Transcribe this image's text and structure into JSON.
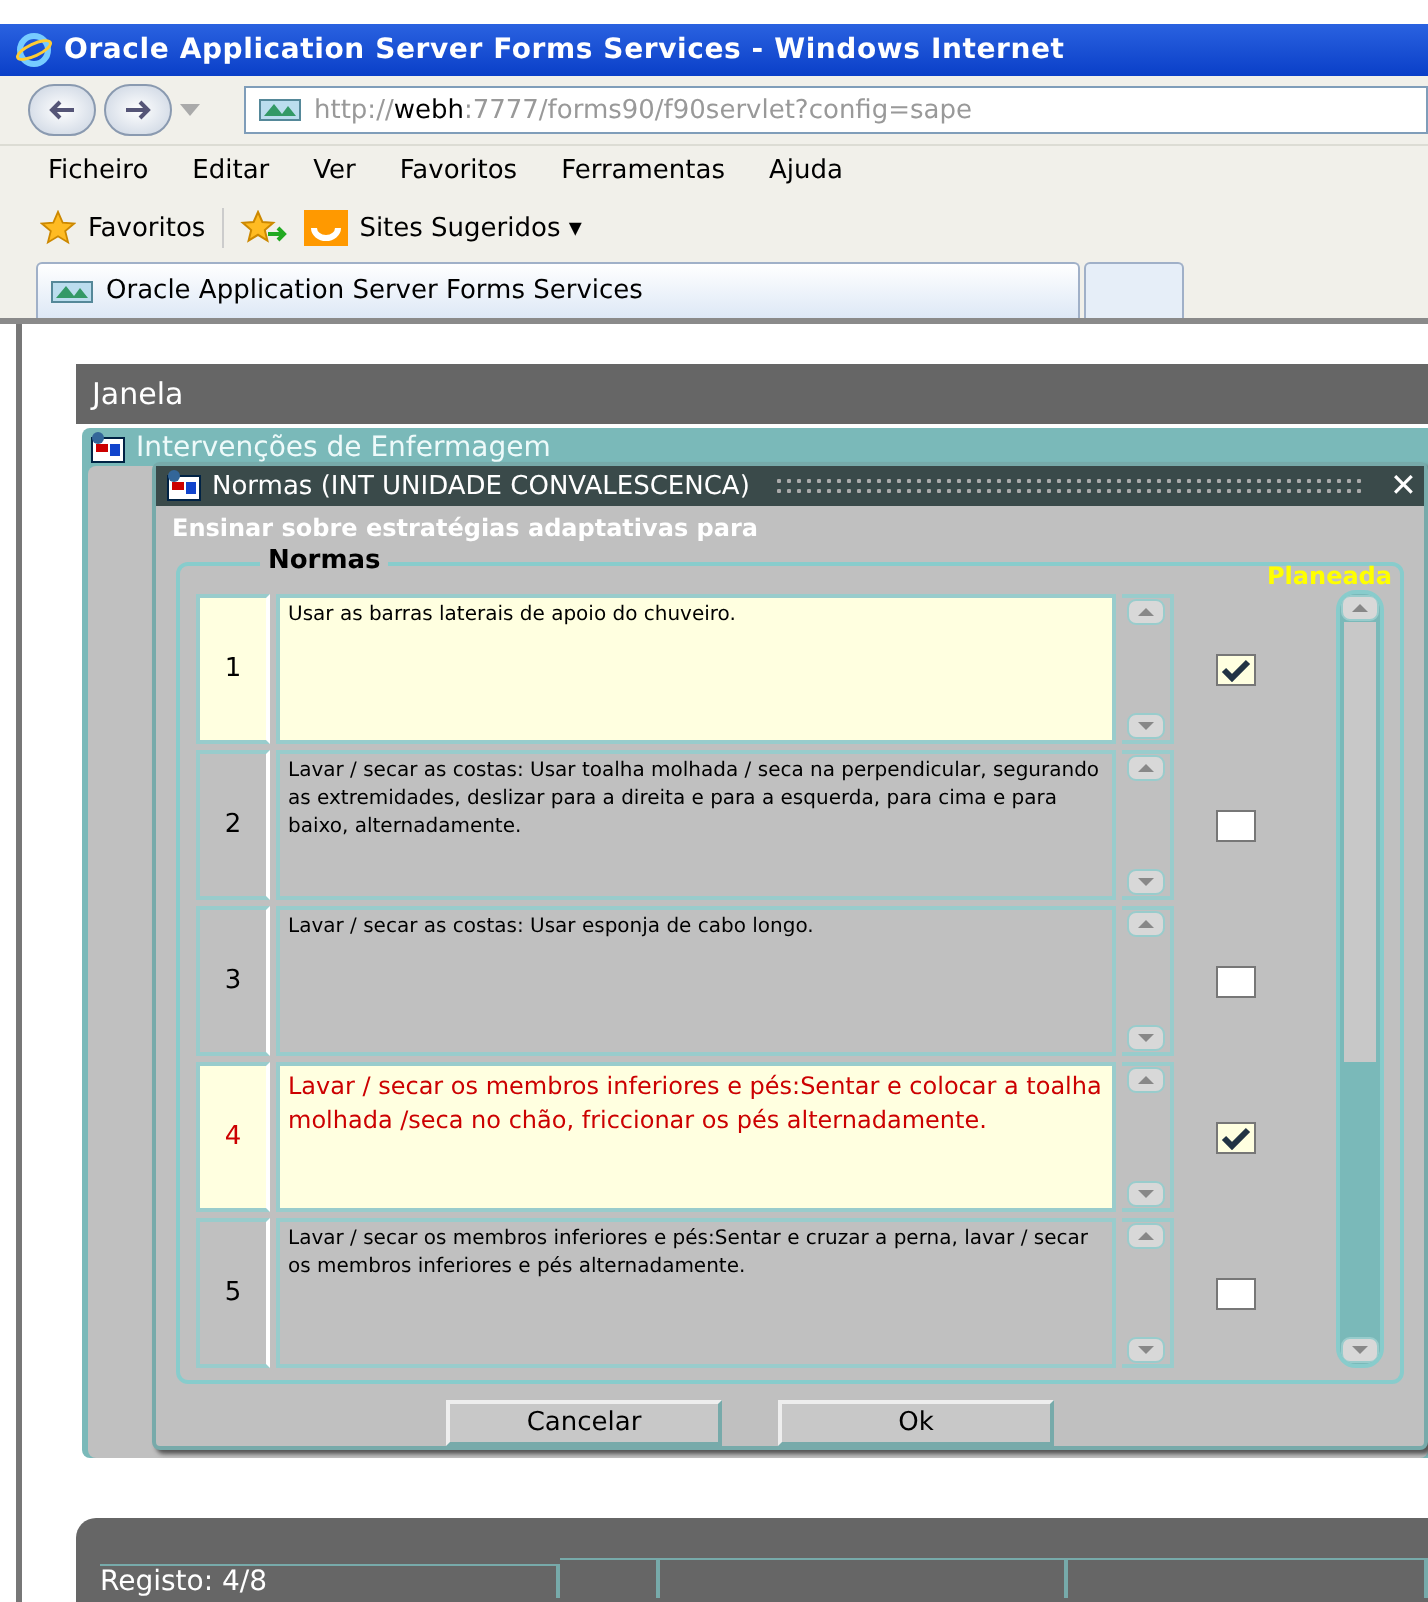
{
  "window": {
    "title": "Oracle Application Server Forms Services - Windows Internet"
  },
  "address_bar": {
    "prefix": "http://",
    "host": "webh",
    "rest": ":7777/forms90/f90servlet?config=sape"
  },
  "menu": [
    "Ficheiro",
    "Editar",
    "Ver",
    "Favoritos",
    "Ferramentas",
    "Ajuda"
  ],
  "favorites_bar": {
    "favorites": "Favoritos",
    "suggested": "Sites Sugeridos ▾"
  },
  "tabs": [
    {
      "label": "Oracle Application Server Forms Services",
      "selected": true
    },
    {
      "selected": false
    }
  ],
  "applet": {
    "menu": "Janela",
    "window_title": "Intervenções de Enfermagem"
  },
  "dialog": {
    "title": "Normas (INT UNIDADE CONVALESCENCA)",
    "close": "✕",
    "subtitle": "Ensinar sobre estratégias adaptativas para",
    "group": "Normas",
    "column": "Planeada",
    "rows": [
      {
        "number": "1",
        "text": "Usar as barras laterais de apoio do chuveiro.",
        "checked": true,
        "current": false
      },
      {
        "number": "2",
        "text": "Lavar / secar as costas: Usar toalha molhada / seca na perpendicular, segurando as extremidades, deslizar para a direita e para a esquerda, para cima e para baixo, alternadamente.",
        "checked": false,
        "current": false
      },
      {
        "number": "3",
        "text": "Lavar / secar as costas: Usar esponja de cabo longo.",
        "checked": false,
        "current": false
      },
      {
        "number": "4",
        "text": "Lavar / secar os membros inferiores e pés:Sentar e colocar a toalha molhada /seca no chão, friccionar os pés alternadamente.",
        "checked": true,
        "current": true
      },
      {
        "number": "5",
        "text": "Lavar / secar os membros inferiores e pés:Sentar e cruzar a perna, lavar / secar os membros inferiores e pés alternadamente.",
        "checked": false,
        "current": false
      }
    ],
    "buttons": [
      "Cancelar",
      "Ok"
    ]
  },
  "status_bar": {
    "record": "Registo: 4/8"
  }
}
